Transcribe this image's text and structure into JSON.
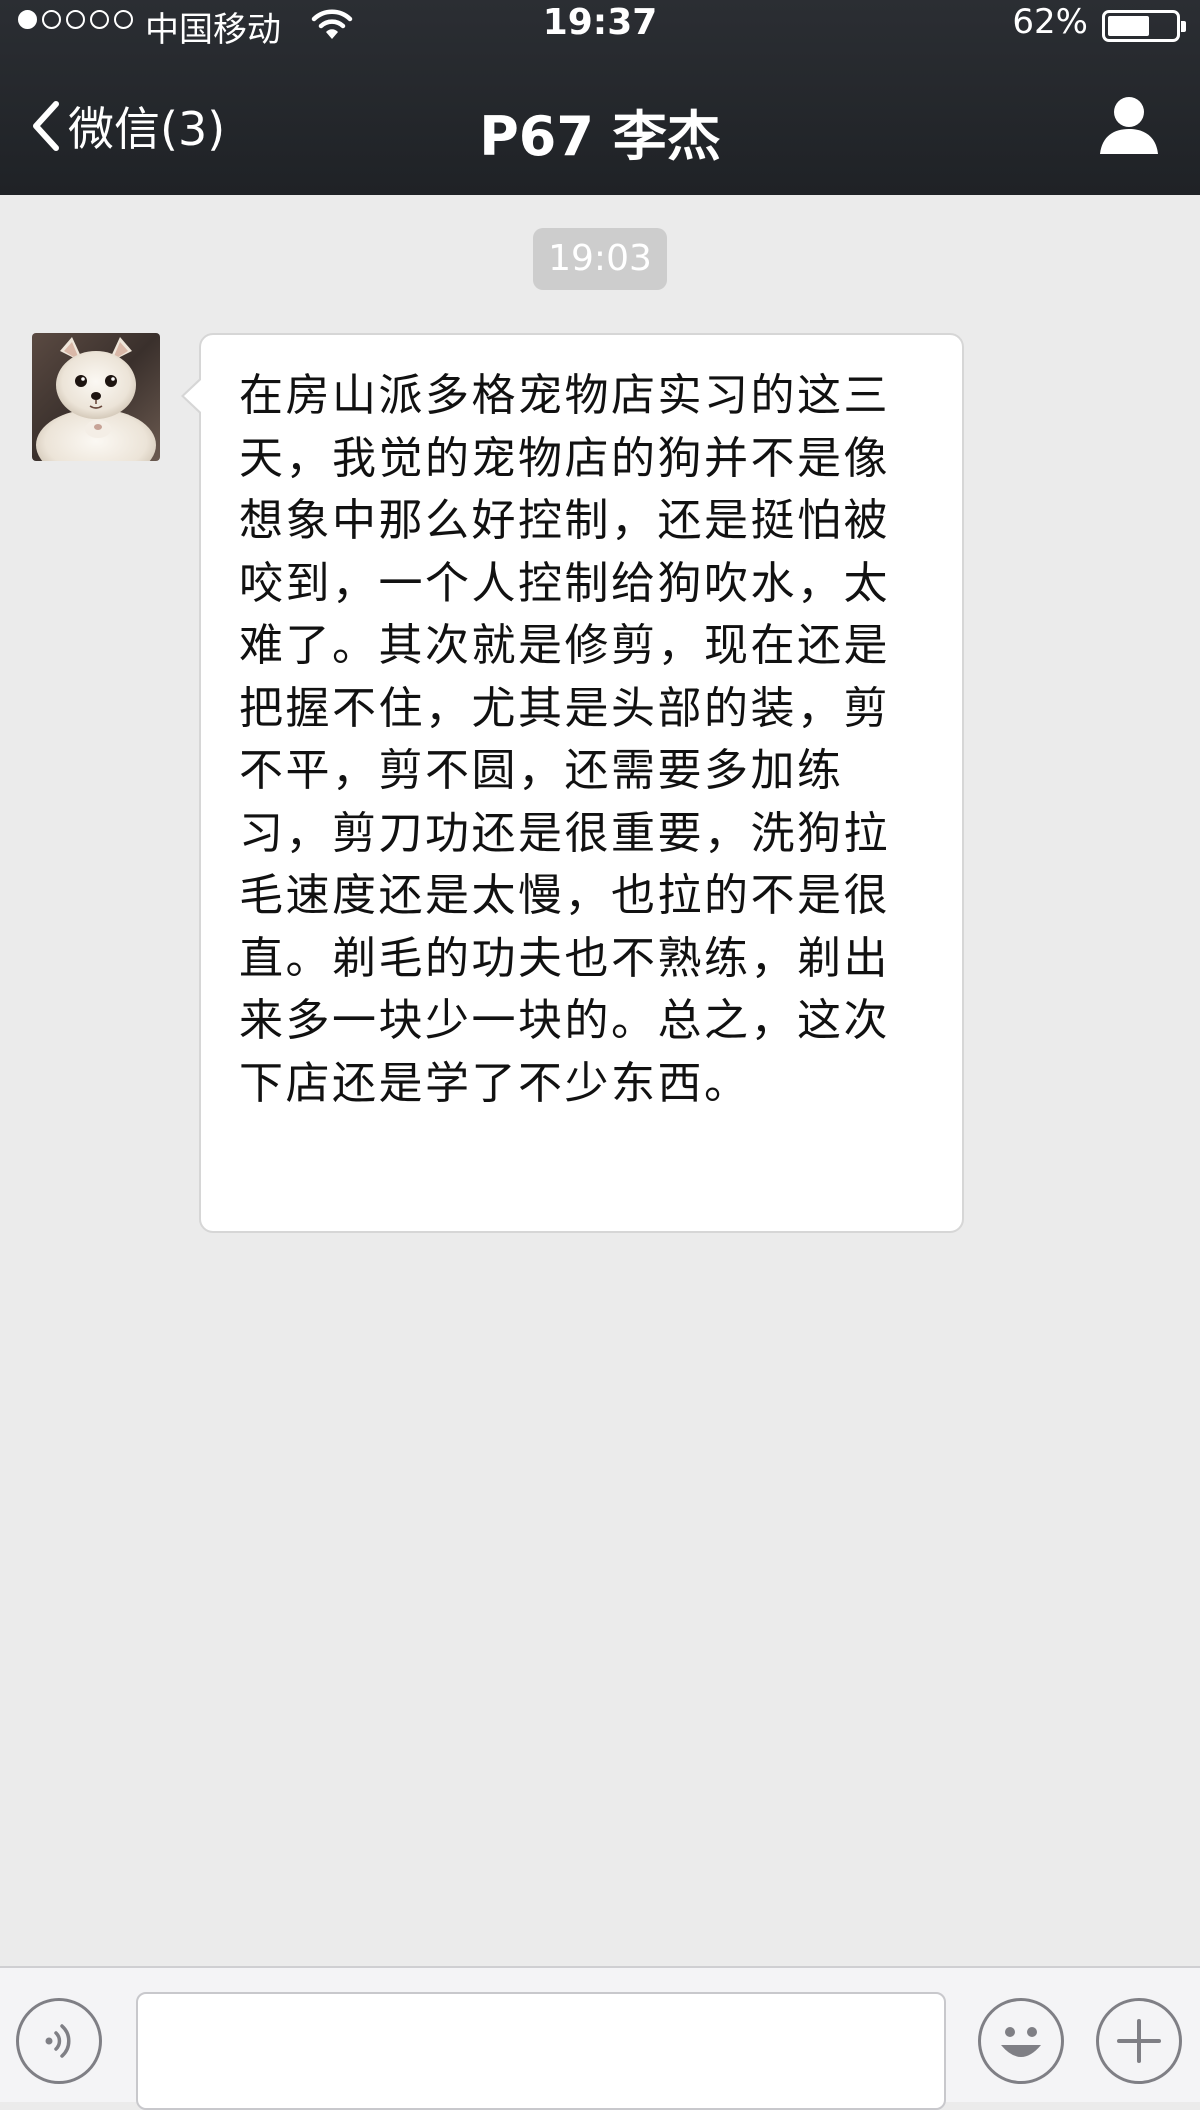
{
  "status_bar": {
    "carrier": "中国移动",
    "time": "19:37",
    "battery_percent_text": "62%",
    "battery_level": 0.62,
    "signal_filled_dots": 1,
    "signal_total_dots": 5
  },
  "nav": {
    "back_label": "微信(3)",
    "title": "P67 李杰"
  },
  "chat": {
    "timestamp": "19:03",
    "messages": [
      {
        "sender": "other",
        "avatar_icon": "dog-avatar",
        "text": "在房山派多格宠物店实习的这三天，我觉的宠物店的狗并不是像想象中那么好控制，还是挺怕被咬到，一个人控制给狗吹水，太难了。其次就是修剪，现在还是把握不住，尤其是头部的装，剪不平，剪不圆，还需要多加练习，剪刀功还是很重要，洗狗拉毛速度还是太慢，也拉的不是很直。剃毛的功夫也不熟练，剃出来多一块少一块的。总之，这次下店还是学了不少东西。"
      }
    ]
  },
  "input_bar": {
    "value": "",
    "icons": [
      "voice-icon",
      "emoji-icon",
      "plus-icon"
    ]
  },
  "colors": {
    "nav_bg": "#2b2e33",
    "chat_bg": "#ebebeb",
    "bubble_bg": "#ffffff",
    "timestamp_chip": "#cdcdcd"
  }
}
